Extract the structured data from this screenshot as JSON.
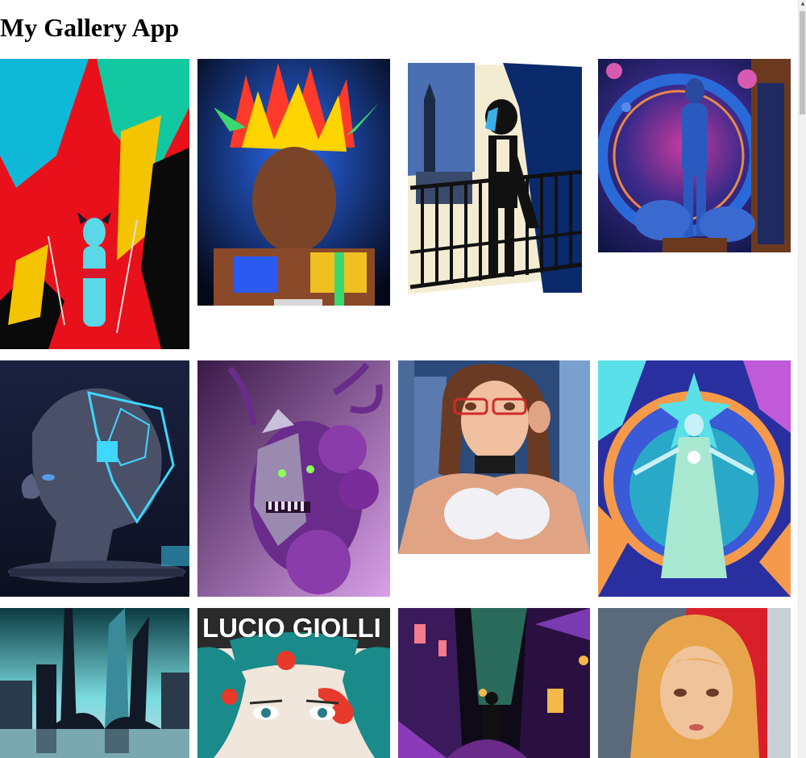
{
  "app": {
    "title": "My Gallery App"
  },
  "gallery": {
    "images": [
      {
        "name": "Cat-eared girl in bikini against red, blue and yellow paint splashes",
        "palette": [
          "#e8101a",
          "#10b8d8",
          "#f5c400",
          "#0a0a0a"
        ]
      },
      {
        "name": "Muscular man with rainbow spiked hair",
        "palette": [
          "#1b4fd8",
          "#ff3a2a",
          "#ffd400",
          "#5a2e18"
        ]
      },
      {
        "name": "Masked dandy on balcony, cream and navy poster",
        "palette": [
          "#0b2a6b",
          "#f4ecd2",
          "#111111",
          "#4a6fb3"
        ]
      },
      {
        "name": "Blue tattooed woman in ornate cosmic portal",
        "palette": [
          "#1e3d8f",
          "#e8884a",
          "#6b3a1e",
          "#c93b9e"
        ]
      },
      {
        "name": "Robotic woman head with circuit hexagons",
        "palette": [
          "#1a2240",
          "#3fd6ff",
          "#4a5068",
          "#0d1020"
        ]
      },
      {
        "name": "Purple horned demon mask with roses",
        "palette": [
          "#6a2c8a",
          "#c77be0",
          "#2a1030",
          "#8aff5a"
        ]
      },
      {
        "name": "Anime woman with red glasses in window",
        "palette": [
          "#2c4a7a",
          "#e0a484",
          "#6a3a22",
          "#d02a2a"
        ]
      },
      {
        "name": "Radiant goddess with star halo mandala",
        "palette": [
          "#2a2fa0",
          "#5ae0e8",
          "#f59a4a",
          "#c05ad8"
        ]
      },
      {
        "name": "Futuristic teal skyline reflected",
        "palette": [
          "#7adbe0",
          "#111826",
          "#2a3a4a",
          "#c8d8e0"
        ]
      },
      {
        "name": "Magazine cover teal-haired woman with red splatter",
        "palette": [
          "#1a8a8a",
          "#e83a2a",
          "#f0e6dc",
          "#2a2a2a"
        ]
      },
      {
        "name": "Night alley with lanterns in purple city",
        "palette": [
          "#3a1a5a",
          "#f5b84a",
          "#2a6a5a",
          "#0e0a18"
        ]
      },
      {
        "name": "Golden-haired girl on red background",
        "palette": [
          "#d8202a",
          "#e8a44a",
          "#f0c49a",
          "#6a3a2a"
        ]
      }
    ],
    "magazine_title": "LUCIO  GIOLLI"
  },
  "colors": {
    "page_background": "#ffffff",
    "title_text": "#000000",
    "scrollbar_track": "#f1f1f1",
    "scrollbar_thumb": "#c1c1c1"
  }
}
